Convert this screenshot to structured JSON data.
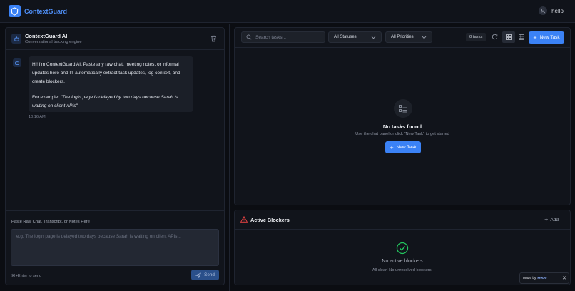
{
  "header": {
    "app_title": "ContextGuard",
    "user_name": "hello"
  },
  "chat": {
    "title": "ContextGuard AI",
    "subtitle": "Conversational tracking engine",
    "message": {
      "text": "Hi! I'm ContextGuard AI. Paste any raw chat, meeting notes, or informal updates here and I'll automatically extract task updates, log context, and create blockers.",
      "example_prefix": "For example: ",
      "example_quote": "\"The login page is delayed by two days because Sarah is waiting on client APIs\"",
      "time": "10:16 AM"
    },
    "input_label": "Paste Raw Chat, Transcript, or Notes Here",
    "input_placeholder": "e.g. The login page is delayed two days because Sarah is waiting on client APIs...",
    "input_value": "",
    "hint": "⌘+Enter to send",
    "send_label": "Send"
  },
  "tasks": {
    "search_placeholder": "Search tasks...",
    "status_filter": "All Statuses",
    "priority_filter": "All Priorities",
    "count_label": "0 tasks",
    "new_task_label": "New Task",
    "empty_title": "No tasks found",
    "empty_subtitle": "Use the chat panel or click \"New Task\" to get started",
    "empty_button_label": "New Task"
  },
  "blockers": {
    "title": "Active Blockers",
    "add_label": "Add",
    "empty_title": "No active blockers",
    "empty_subtitle": "All clear! No unresolved blockers."
  },
  "badge": {
    "made_by": "Made by",
    "brand": "MeDo",
    "close": "✕"
  },
  "colors": {
    "accent": "#3b82f6",
    "background": "#0b0d12",
    "panel": "#11141b",
    "success": "#22c55e",
    "danger": "#ef4444"
  },
  "icons": [
    "shield-logo-icon",
    "user-icon",
    "bot-icon",
    "trash-icon",
    "search-icon",
    "chevron-down-icon",
    "refresh-icon",
    "grid-view-icon",
    "list-view-icon",
    "plus-icon",
    "list-checklist-icon",
    "warning-triangle-icon",
    "check-circle-icon",
    "send-icon",
    "close-icon"
  ]
}
